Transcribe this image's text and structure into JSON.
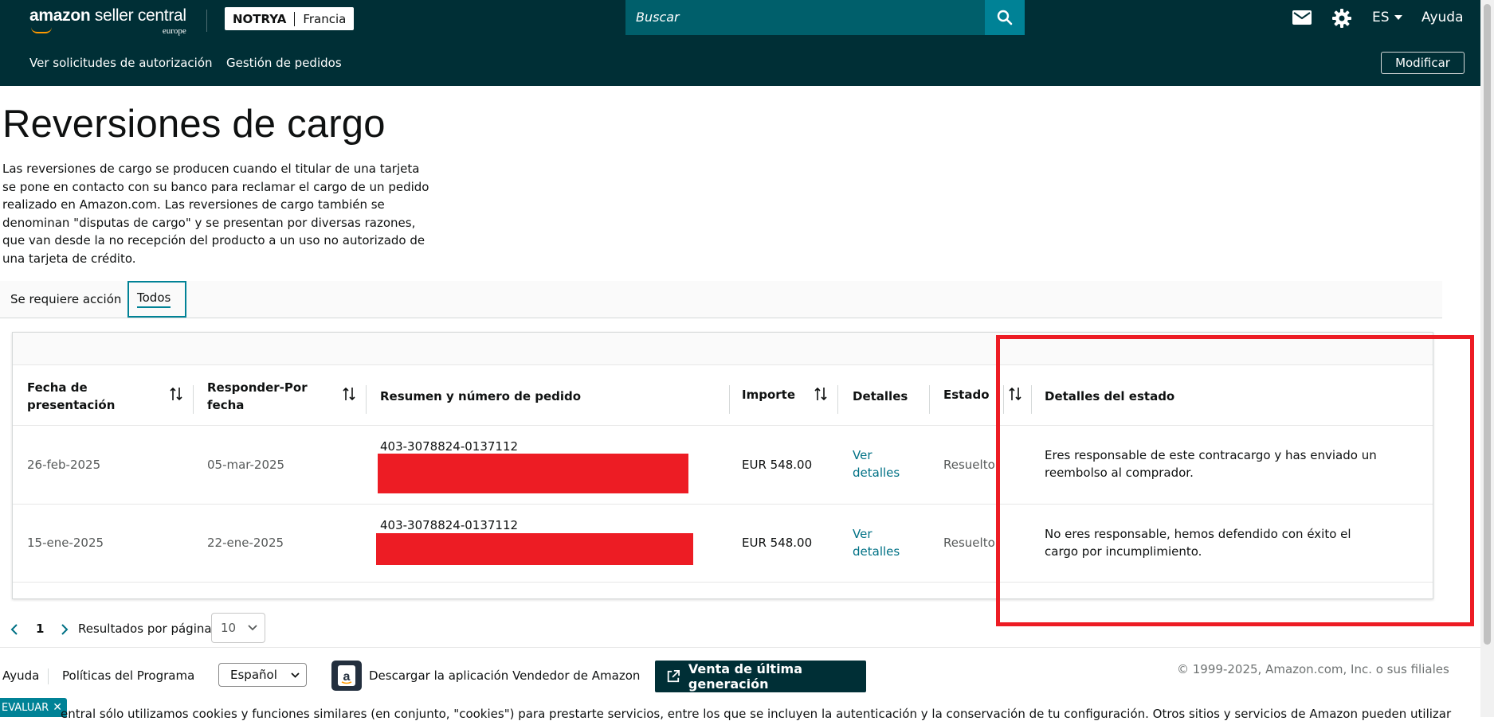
{
  "header": {
    "logo_main": "amazon",
    "logo_rest": " seller central",
    "logo_region": "europe",
    "store_name": "NOTRYA",
    "store_country": "Francia",
    "search_placeholder": "Buscar",
    "language": "ES",
    "help": "Ayuda"
  },
  "subnav": {
    "items": [
      "Ver solicitudes de autorización",
      "Gestión de pedidos"
    ],
    "modify_button": "Modificar"
  },
  "page": {
    "title": "Reversiones de cargo",
    "intro": "Las reversiones de cargo se producen cuando el titular de una tarjeta se pone en contacto con su banco para reclamar el cargo de un pedido realizado en Amazon.com. Las reversiones de cargo también se denominan \"disputas de cargo\" y se presentan por diversas razones, que van desde la no recepción del producto a un uso no autorizado de una tarjeta de crédito."
  },
  "tabs": [
    "Se requiere acción",
    "Todos"
  ],
  "active_tab": "Todos",
  "table": {
    "columns": [
      "Fecha de presentación",
      "Responder-Por fecha",
      "Resumen y número de pedido",
      "Importe",
      "Detalles",
      "Estado",
      "Detalles del estado"
    ],
    "rows": [
      {
        "filed": "26-feb-2025",
        "respond_by": "05-mar-2025",
        "order": "403-3078824-0137112",
        "amount": "EUR 548.00",
        "details": "Ver detalles",
        "status": "Resuelto",
        "status_details": "Eres responsable de este contracargo y has enviado un reembolso al comprador."
      },
      {
        "filed": "15-ene-2025",
        "respond_by": "22-ene-2025",
        "order": "403-3078824-0137112",
        "amount": "EUR 548.00",
        "details": "Ver detalles",
        "status": "Resuelto",
        "status_details": "No eres responsable, hemos defendido con éxito el cargo por incumplimiento."
      }
    ]
  },
  "pagination": {
    "current_page": "1",
    "per_page_label": "Resultados por página",
    "per_page_value": "10"
  },
  "footer": {
    "help": "Ayuda",
    "policies": "Políticas del Programa",
    "language_select": "Español",
    "app_download": "Descargar la aplicación Vendedor de Amazon",
    "next_gen": "Venta de última generación",
    "copyright": "© 1999-2025, Amazon.com, Inc. o sus filiales",
    "feedback": "EVALUAR",
    "cookie_text": "entral sólo utilizamos cookies y funciones similares (en conjunto, \"cookies\") para prestarte servicios, entre los que se incluyen la autenticación y la conservación de tu configuración. Otros sitios y servicios de Amazon pueden utilizar"
  },
  "colors": {
    "header_bg": "#002f36",
    "accent": "#008296",
    "link": "#007185",
    "annotation_red": "#ed1c24"
  }
}
